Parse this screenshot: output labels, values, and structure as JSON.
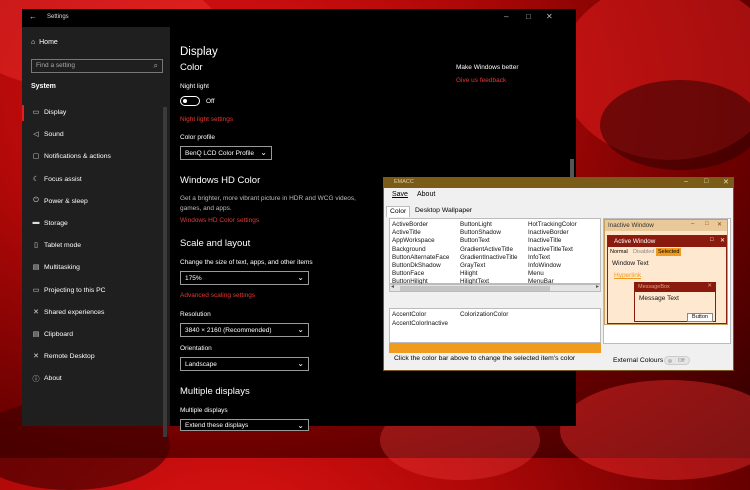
{
  "settings": {
    "title": "Settings",
    "home": "Home",
    "search_placeholder": "Find a setting",
    "section": "System",
    "nav": [
      {
        "icon": "display-icon",
        "glyph": "▭",
        "label": "Display",
        "active": true
      },
      {
        "icon": "sound-icon",
        "glyph": "◁",
        "label": "Sound"
      },
      {
        "icon": "notifications-icon",
        "glyph": "▢",
        "label": "Notifications & actions"
      },
      {
        "icon": "focus-assist-icon",
        "glyph": "☾",
        "label": "Focus assist"
      },
      {
        "icon": "power-icon",
        "glyph": "⏻",
        "label": "Power & sleep"
      },
      {
        "icon": "storage-icon",
        "glyph": "▬",
        "label": "Storage"
      },
      {
        "icon": "tablet-mode-icon",
        "glyph": "▯",
        "label": "Tablet mode"
      },
      {
        "icon": "multitasking-icon",
        "glyph": "▤",
        "label": "Multitasking"
      },
      {
        "icon": "projecting-icon",
        "glyph": "▭",
        "label": "Projecting to this PC"
      },
      {
        "icon": "shared-experiences-icon",
        "glyph": "✕",
        "label": "Shared experiences"
      },
      {
        "icon": "clipboard-icon",
        "glyph": "▤",
        "label": "Clipboard"
      },
      {
        "icon": "remote-desktop-icon",
        "glyph": "✕",
        "label": "Remote Desktop"
      },
      {
        "icon": "about-icon",
        "glyph": "ⓘ",
        "label": "About"
      }
    ],
    "page_title": "Display",
    "color_heading": "Color",
    "night_light_label": "Night light",
    "night_light_state": "Off",
    "night_light_settings": "Night light settings",
    "color_profile_label": "Color profile",
    "color_profile_value": "BenQ LCD Color Profile",
    "hd_heading": "Windows HD Color",
    "hd_desc_1": "Get a brighter, more vibrant picture in HDR and WCG videos,",
    "hd_desc_2": "games, and apps.",
    "hd_link": "Windows HD Color settings",
    "scale_heading": "Scale and layout",
    "scale_label": "Change the size of text, apps, and other items",
    "scale_value": "175%",
    "advanced_scaling": "Advanced scaling settings",
    "resolution_label": "Resolution",
    "resolution_value": "3840 × 2160 (Recommended)",
    "orientation_label": "Orientation",
    "orientation_value": "Landscape",
    "multiple_heading": "Multiple displays",
    "multiple_label": "Multiple displays",
    "multiple_value": "Extend these displays",
    "better_heading": "Make Windows better",
    "feedback_link": "Give us feedback"
  },
  "app": {
    "title": "EMACC",
    "menu": [
      "Save",
      "About"
    ],
    "tabs": [
      "Color",
      "Desktop Wallpaper"
    ],
    "colors": [
      [
        "ActiveBorder",
        "ActiveTitle",
        "AppWorkspace",
        "Background",
        "ButtonAlternateFace",
        "ButtonDkShadow",
        "ButtonFace",
        "ButtonHilight"
      ],
      [
        "ButtonLight",
        "ButtonShadow",
        "ButtonText",
        "GradientActiveTitle",
        "GradientInactiveTitle",
        "GrayText",
        "Hilight",
        "HilightText"
      ],
      [
        "HotTrackingColor",
        "InactiveBorder",
        "InactiveTitle",
        "InactiveTitleText",
        "InfoText",
        "InfoWindow",
        "Menu",
        "MenuBar"
      ]
    ],
    "accent": [
      "AccentColor",
      "ColorizationColor",
      "AccentColorInactive"
    ],
    "click_info": "Click the color bar above to change the selected item's color",
    "preview": {
      "inactive_window": "Inactive Window",
      "active_window": "Active Window",
      "normal": "Normal",
      "disabled": "Disabled",
      "selected": "Selected",
      "window_text": "Window Text",
      "hyperlink": "Hyperlink",
      "messagebox": "MessageBox",
      "message_text": "Message Text",
      "button": "Button"
    },
    "external_colours": "External Colours",
    "external_state": "Off",
    "accent_color": "#f09a1e"
  }
}
